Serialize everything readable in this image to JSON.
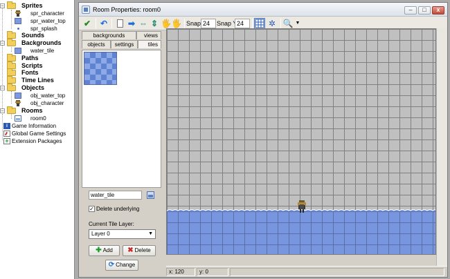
{
  "tree": {
    "sprites": {
      "label": "Sprites",
      "items": [
        "spr_character",
        "spr_water_top",
        "spr_splash"
      ]
    },
    "sounds": {
      "label": "Sounds"
    },
    "backgrounds": {
      "label": "Backgrounds",
      "items": [
        "water_tile"
      ]
    },
    "paths": {
      "label": "Paths"
    },
    "scripts": {
      "label": "Scripts"
    },
    "fonts": {
      "label": "Fonts"
    },
    "timelines": {
      "label": "Time Lines"
    },
    "objects": {
      "label": "Objects",
      "items": [
        "obj_water_top",
        "obj_character"
      ]
    },
    "rooms": {
      "label": "Rooms",
      "items": [
        "room0"
      ]
    },
    "game_info": "Game Information",
    "global_settings": "Global Game Settings",
    "extensions": "Extension Packages"
  },
  "window": {
    "title": "Room Properties: room0",
    "min": "–",
    "max": "□",
    "close": "x"
  },
  "toolbar": {
    "snap_x_label": "Snap X:",
    "snap_x": "24",
    "snap_y_label": "Snap Y:",
    "snap_y": "24",
    "accent": "#1e6ed8"
  },
  "tabs": {
    "backgrounds": "backgrounds",
    "views": "views",
    "objects": "objects",
    "settings": "settings",
    "tiles": "tiles"
  },
  "tiles_panel": {
    "tile_name": "water_tile",
    "delete_underlying": "Delete underlying",
    "delete_underlying_checked": true,
    "layer_label": "Current Tile Layer:",
    "layer_value": "Layer 0",
    "add": "Add",
    "delete": "Delete",
    "change": "Change"
  },
  "room": {
    "grid_color": "#c0c0c0",
    "water_color": "#7895e0"
  },
  "status": {
    "x": "x: 120",
    "y": "y: 0"
  }
}
